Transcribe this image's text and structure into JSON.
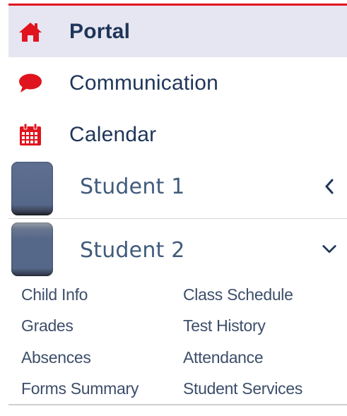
{
  "nav": {
    "items": [
      {
        "label": "Portal",
        "icon": "home-icon",
        "active": true
      },
      {
        "label": "Communication",
        "icon": "speech-bubble-icon",
        "active": false
      },
      {
        "label": "Calendar",
        "icon": "calendar-icon",
        "active": false
      }
    ]
  },
  "students": [
    {
      "label": "Student 1",
      "expanded": false,
      "chevron": "chevron-left-icon"
    },
    {
      "label": "Student 2",
      "expanded": true,
      "chevron": "chevron-down-icon"
    }
  ],
  "student_menu": {
    "left": [
      "Child Info",
      "Grades",
      "Absences",
      "Forms Summary"
    ],
    "right": [
      "Class Schedule",
      "Test History",
      "Attendance",
      "Student Services"
    ]
  },
  "colors": {
    "accent_red": "#e0141e",
    "nav_text": "#1f3559",
    "student_text": "#415c7c",
    "active_bg": "#e6e6f2",
    "chevron": "#1f3559"
  }
}
